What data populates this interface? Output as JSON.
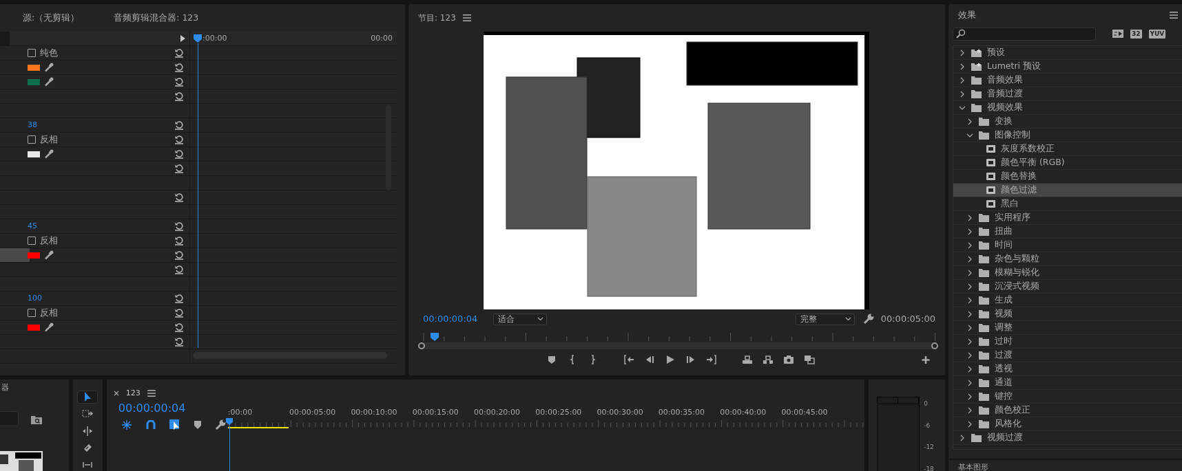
{
  "source_panel": {
    "tabs": [
      "源:（无剪辑）",
      "音频剪辑混合器: 123"
    ],
    "ruler": [
      ":00:00",
      "00:00"
    ],
    "rows": [
      {
        "kind": "checkbox",
        "label": "纯色",
        "checked": false,
        "selected": false
      },
      {
        "kind": "color",
        "color": "#ff7518",
        "selected": false
      },
      {
        "kind": "color",
        "color": "#0c6b4d",
        "selected": false
      },
      {
        "kind": "reset",
        "selected": false
      },
      {
        "kind": "spacer",
        "selected": false
      },
      {
        "kind": "value",
        "value": "38",
        "selected": false
      },
      {
        "kind": "checkbox",
        "label": "反相",
        "checked": false,
        "selected": false
      },
      {
        "kind": "color",
        "color": "#e8e8e8",
        "selected": false
      },
      {
        "kind": "reset",
        "selected": false
      },
      {
        "kind": "spacer",
        "selected": false
      },
      {
        "kind": "reset",
        "selected": false
      },
      {
        "kind": "spacer",
        "selected": false
      },
      {
        "kind": "value",
        "value": "45",
        "selected": false
      },
      {
        "kind": "checkbox",
        "label": "反相",
        "checked": false,
        "selected": false
      },
      {
        "kind": "color",
        "color": "#ff0000",
        "selected": true
      },
      {
        "kind": "reset",
        "selected": false
      },
      {
        "kind": "spacer",
        "selected": false
      },
      {
        "kind": "value",
        "value": "100",
        "selected": false
      },
      {
        "kind": "checkbox",
        "label": "反相",
        "checked": false,
        "selected": false
      },
      {
        "kind": "color",
        "color": "#ff0000",
        "selected": false
      },
      {
        "kind": "reset",
        "selected": false
      },
      {
        "kind": "spacer",
        "selected": false
      }
    ]
  },
  "program": {
    "title": "节目: 123",
    "timecode": "00:00:00:04",
    "zoom": "适合",
    "quality": "完整",
    "duration": "00:00:05:00"
  },
  "project": {
    "title": "器"
  },
  "tools": [
    {
      "selected": true
    },
    {
      "selected": false
    },
    {
      "selected": false
    },
    {
      "selected": false
    },
    {
      "selected": false
    }
  ],
  "timeline": {
    "title": "123",
    "timecode": "00:00:00:04",
    "ruler": [
      ":00:00",
      "00:00:05:00",
      "00:00:10:00",
      "00:00:15:00",
      "00:00:20:00",
      "00:00:25:00",
      "00:00:30:00",
      "00:00:35:00",
      "00:00:40:00",
      "00:00:45:00"
    ]
  },
  "meter": {
    "scale": [
      "0",
      "-6",
      "-12",
      "-18"
    ]
  },
  "effects": {
    "title": "效果",
    "badges": [
      "32",
      "YUV"
    ],
    "next_panel": "基本图形",
    "tree": [
      {
        "label": "预设",
        "kind": "preset_bin",
        "expanded": false,
        "selected": false
      },
      {
        "label": "Lumetri 预设",
        "kind": "preset_bin",
        "expanded": false,
        "selected": false
      },
      {
        "label": "音频效果",
        "kind": "bin",
        "expanded": false,
        "selected": false
      },
      {
        "label": "音频过渡",
        "kind": "bin",
        "expanded": false,
        "selected": false
      },
      {
        "label": "视频效果",
        "kind": "bin",
        "expanded": true,
        "selected": false,
        "children": [
          {
            "label": "变换",
            "kind": "bin",
            "expanded": false,
            "selected": false
          },
          {
            "label": "图像控制",
            "kind": "bin",
            "expanded": true,
            "selected": false,
            "children": [
              {
                "label": "灰度系数校正",
                "kind": "effect",
                "selected": false
              },
              {
                "label": "颜色平衡 (RGB)",
                "kind": "effect",
                "selected": false
              },
              {
                "label": "颜色替换",
                "kind": "effect",
                "selected": false
              },
              {
                "label": "颜色过滤",
                "kind": "effect",
                "selected": true
              },
              {
                "label": "黑白",
                "kind": "effect",
                "selected": false
              }
            ]
          },
          {
            "label": "实用程序",
            "kind": "bin",
            "expanded": false,
            "selected": false
          },
          {
            "label": "扭曲",
            "kind": "bin",
            "expanded": false,
            "selected": false
          },
          {
            "label": "时间",
            "kind": "bin",
            "expanded": false,
            "selected": false
          },
          {
            "label": "杂色与颗粒",
            "kind": "bin",
            "expanded": false,
            "selected": false
          },
          {
            "label": "模糊与锐化",
            "kind": "bin",
            "expanded": false,
            "selected": false
          },
          {
            "label": "沉浸式视频",
            "kind": "bin",
            "expanded": false,
            "selected": false
          },
          {
            "label": "生成",
            "kind": "bin",
            "expanded": false,
            "selected": false
          },
          {
            "label": "视频",
            "kind": "bin",
            "expanded": false,
            "selected": false
          },
          {
            "label": "调整",
            "kind": "bin",
            "expanded": false,
            "selected": false
          },
          {
            "label": "过时",
            "kind": "bin",
            "expanded": false,
            "selected": false
          },
          {
            "label": "过渡",
            "kind": "bin",
            "expanded": false,
            "selected": false
          },
          {
            "label": "透视",
            "kind": "bin",
            "expanded": false,
            "selected": false
          },
          {
            "label": "通道",
            "kind": "bin",
            "expanded": false,
            "selected": false
          },
          {
            "label": "键控",
            "kind": "bin",
            "expanded": false,
            "selected": false
          },
          {
            "label": "颜色校正",
            "kind": "bin",
            "expanded": false,
            "selected": false
          },
          {
            "label": "风格化",
            "kind": "bin",
            "expanded": false,
            "selected": false
          }
        ]
      },
      {
        "label": "视频过渡",
        "kind": "bin",
        "expanded": false,
        "selected": false
      }
    ]
  }
}
